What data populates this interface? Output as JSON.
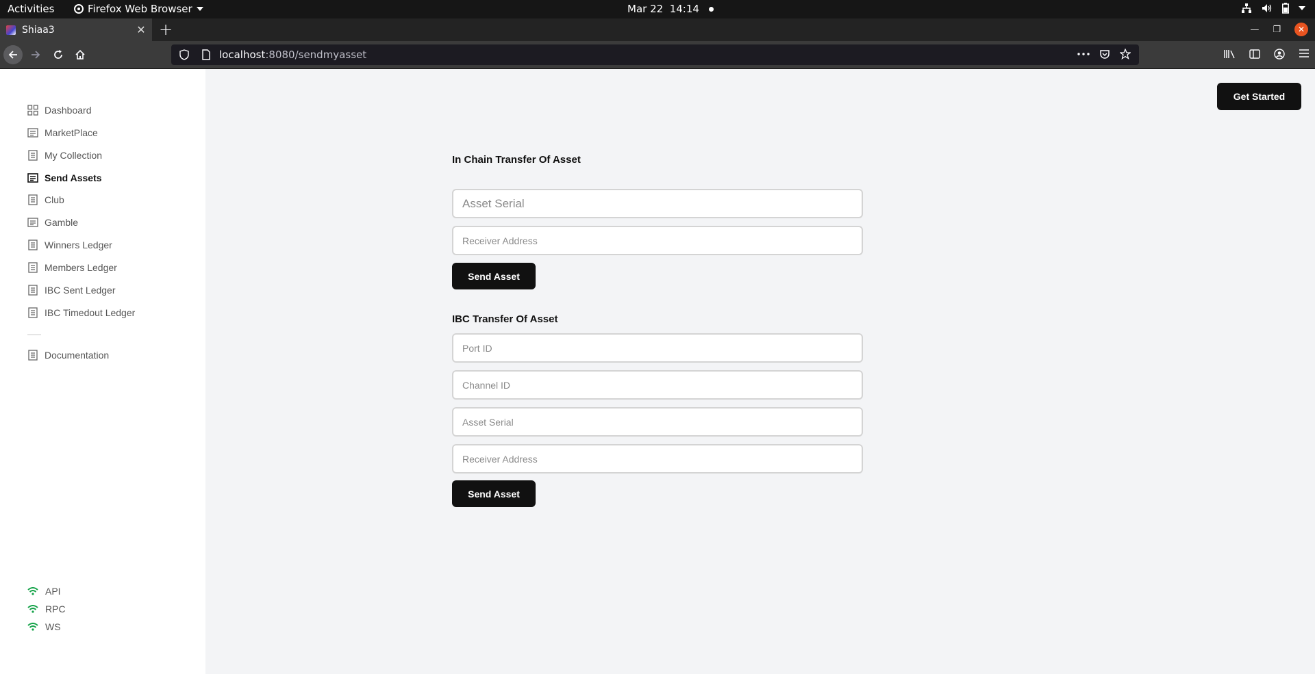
{
  "system_bar": {
    "activities": "Activities",
    "app_name": "Firefox Web Browser",
    "date": "Mar 22",
    "time": "14:14"
  },
  "browser": {
    "tab_title": "Shiaa3",
    "url_host": "localhost",
    "url_path": ":8080/sendmyasset"
  },
  "header": {
    "get_started_label": "Get Started"
  },
  "sidebar": {
    "items": [
      {
        "label": "Dashboard",
        "icon": "grid-icon"
      },
      {
        "label": "MarketPlace",
        "icon": "document-icon"
      },
      {
        "label": "My Collection",
        "icon": "ledger-icon"
      },
      {
        "label": "Send Assets",
        "icon": "document-icon",
        "active": true
      },
      {
        "label": "Club",
        "icon": "ledger-icon"
      },
      {
        "label": "Gamble",
        "icon": "document-icon"
      },
      {
        "label": "Winners Ledger",
        "icon": "ledger-icon"
      },
      {
        "label": "Members Ledger",
        "icon": "ledger-icon"
      },
      {
        "label": "IBC Sent Ledger",
        "icon": "ledger-icon"
      },
      {
        "label": "IBC Timedout Ledger",
        "icon": "ledger-icon"
      }
    ],
    "documentation": "Documentation",
    "status": [
      {
        "label": "API"
      },
      {
        "label": "RPC"
      },
      {
        "label": "WS"
      }
    ],
    "status_color": "#16a34a"
  },
  "in_chain": {
    "title": "In Chain Transfer Of Asset",
    "asset_serial_placeholder": "Asset Serial",
    "receiver_placeholder": "Receiver Address",
    "send_label": "Send Asset"
  },
  "ibc": {
    "title": "IBC Transfer Of Asset",
    "port_placeholder": "Port ID",
    "channel_placeholder": "Channel ID",
    "asset_serial_placeholder": "Asset Serial",
    "receiver_placeholder": "Receiver Address",
    "send_label": "Send Asset"
  }
}
